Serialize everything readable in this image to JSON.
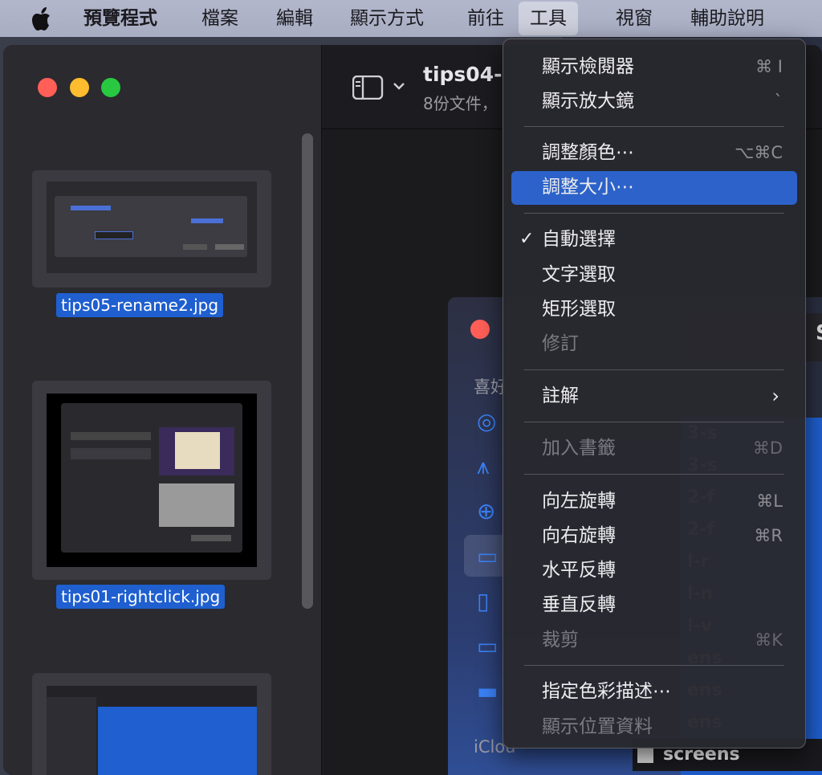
{
  "menubar": {
    "app": "預覽程式",
    "items": [
      "檔案",
      "編輯",
      "顯示方式",
      "前往",
      "工具",
      "視窗",
      "輔助說明"
    ]
  },
  "window": {
    "title": "tips04-",
    "subtitle": "8份文件，",
    "thumbnails": [
      {
        "label": "tips05-rename2.jpg"
      },
      {
        "label": "tips01-rightclick.jpg"
      },
      {
        "label": ""
      }
    ]
  },
  "menu": {
    "items": [
      {
        "label": "顯示檢閱器",
        "shortcut": "⌘ I"
      },
      {
        "label": "顯示放大鏡",
        "shortcut": "`"
      },
      {
        "label": "調整顏色⋯",
        "shortcut": "⌥⌘C"
      },
      {
        "label": "調整大小⋯",
        "shortcut": ""
      },
      {
        "label": "自動選擇",
        "shortcut": "",
        "checked": "✓"
      },
      {
        "label": "文字選取",
        "shortcut": ""
      },
      {
        "label": "矩形選取",
        "shortcut": ""
      },
      {
        "label": "修訂",
        "shortcut": ""
      },
      {
        "label": "註解",
        "shortcut": "",
        "submenu": "›"
      },
      {
        "label": "加入書籤",
        "shortcut": "⌘D"
      },
      {
        "label": "向左旋轉",
        "shortcut": "⌘L"
      },
      {
        "label": "向右旋轉",
        "shortcut": "⌘R"
      },
      {
        "label": "水平反轉",
        "shortcut": ""
      },
      {
        "label": "垂直反轉",
        "shortcut": ""
      },
      {
        "label": "裁剪",
        "shortcut": "⌘K"
      },
      {
        "label": "指定色彩描述⋯",
        "shortcut": ""
      },
      {
        "label": "顯示位置資料",
        "shortcut": ""
      }
    ]
  },
  "finder": {
    "section_label": "喜好",
    "icloud_label": "iClou",
    "header_letter": "S",
    "rows": [
      "3-s",
      "3-s",
      "2-f",
      "2-f",
      "l-r",
      "l-n",
      "l-v",
      "ens",
      "ens",
      "ens",
      "screens"
    ]
  },
  "colors": {
    "highlight": "#2c62c9",
    "selection": "#1f5fcf"
  }
}
